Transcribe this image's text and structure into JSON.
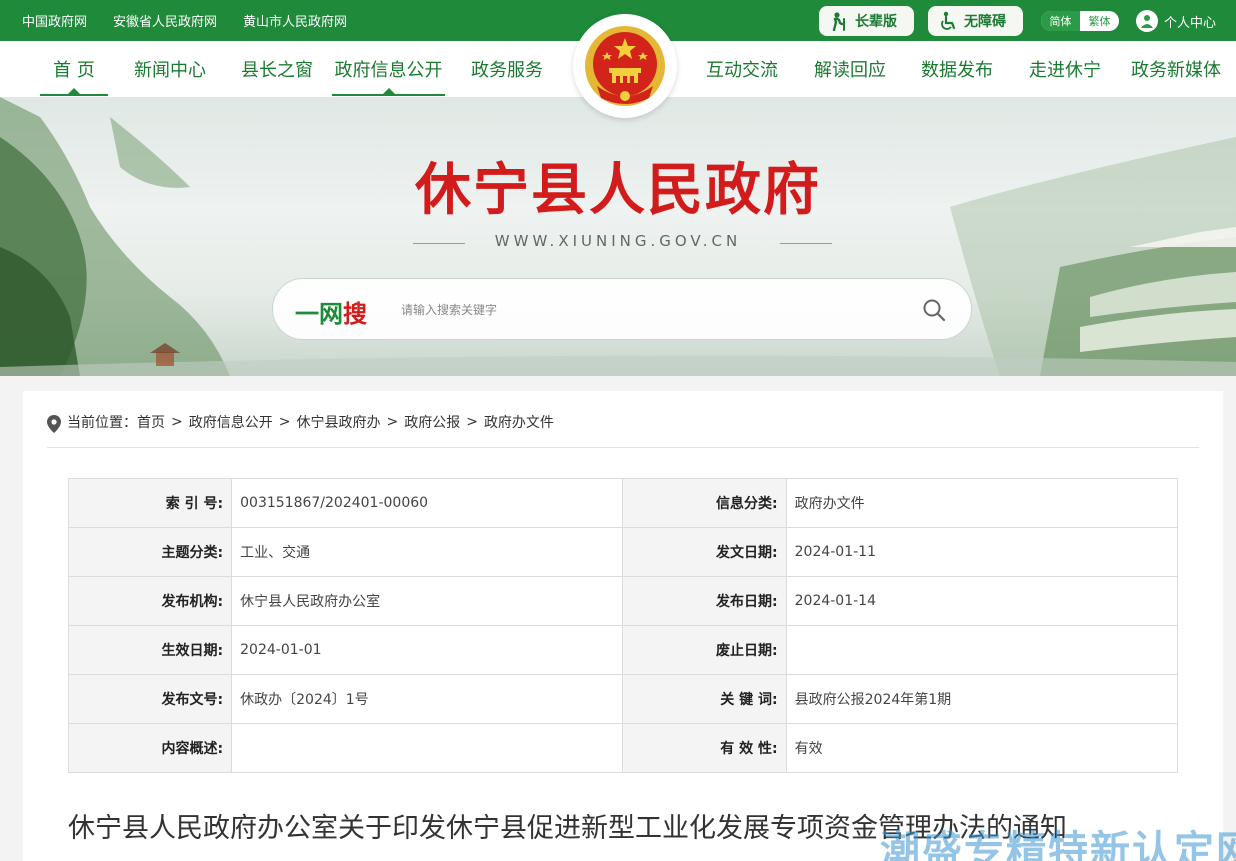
{
  "topbar": {
    "links": [
      "中国政府网",
      "安徽省人民政府网",
      "黄山市人民政府网"
    ],
    "elder_mode": "长辈版",
    "accessibility": "无障碍",
    "lang_simplified": "简体",
    "lang_traditional": "繁体",
    "user_center": "个人中心"
  },
  "nav": {
    "items": [
      "首 页",
      "新闻中心",
      "县长之窗",
      "政府信息公开",
      "政务服务",
      "互动交流",
      "解读回应",
      "数据发布",
      "走进休宁",
      "政务新媒体"
    ]
  },
  "banner": {
    "site_name": "休宁县人民政府",
    "site_url": "WWW.XIUNING.GOV.CN"
  },
  "search": {
    "logo_green": "一网",
    "logo_red": "搜",
    "placeholder": "请输入搜索关键字"
  },
  "breadcrumb": {
    "prefix": "当前位置：",
    "items": [
      "首页",
      "政府信息公开",
      "休宁县政府办",
      "政府公报",
      "政府办文件"
    ],
    "separator": ">"
  },
  "meta_table": {
    "rows": [
      [
        {
          "label": "索 引 号:",
          "value": "003151867/202401-00060"
        },
        {
          "label": "信息分类:",
          "value": "政府办文件"
        }
      ],
      [
        {
          "label": "主题分类:",
          "value": "工业、交通"
        },
        {
          "label": "发文日期:",
          "value": "2024-01-11"
        }
      ],
      [
        {
          "label": "发布机构:",
          "value": "休宁县人民政府办公室"
        },
        {
          "label": "发布日期:",
          "value": "2024-01-14"
        }
      ],
      [
        {
          "label": "生效日期:",
          "value": "2024-01-01"
        },
        {
          "label": "废止日期:",
          "value": ""
        }
      ],
      [
        {
          "label": "发布文号:",
          "value": "休政办〔2024〕1号"
        },
        {
          "label": "关 键 词:",
          "value": "县政府公报2024年第1期"
        }
      ],
      [
        {
          "label": "内容概述:",
          "value": ""
        },
        {
          "label": "有 效 性:",
          "value": "有效"
        }
      ]
    ]
  },
  "document": {
    "title": "休宁县人民政府办公室关于印发休宁县促进新型工业化发展专项资金管理办法的通知"
  },
  "watermark": "潮盛专精特新认定网",
  "colors": {
    "brand_green": "#1e8a3a",
    "title_red": "#d21c1c"
  }
}
